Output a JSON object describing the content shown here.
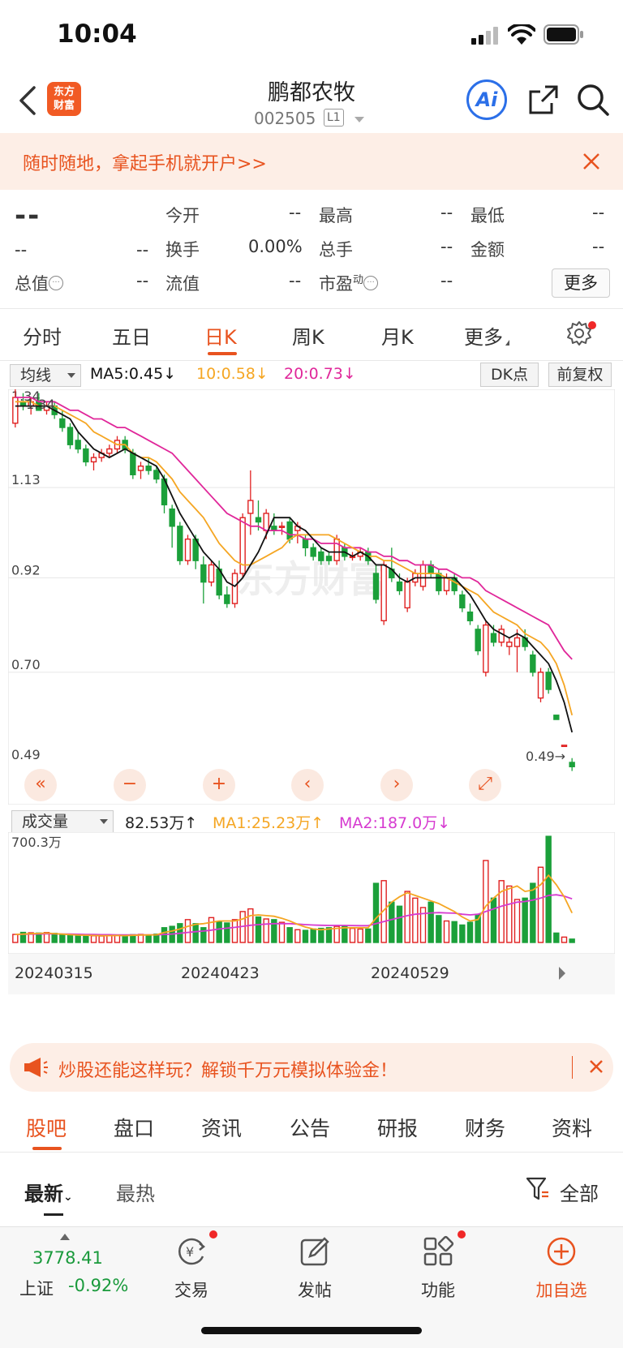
{
  "status_bar": {
    "time": "10:04"
  },
  "header": {
    "logo_text_line1": "东方",
    "logo_text_line2": "财富",
    "stock_name": "鹏都农牧",
    "stock_code": "002505",
    "level": "L1",
    "ai_label": "Ai"
  },
  "promo_top": {
    "text": "随时随地，拿起手机就开户>>"
  },
  "quote": {
    "price": "--",
    "change": "--",
    "change_pct": "--",
    "rows": [
      [
        {
          "label": "今开",
          "value": "--"
        },
        {
          "label": "最高",
          "value": "--"
        },
        {
          "label": "最低",
          "value": "--"
        }
      ],
      [
        {
          "label": "换手",
          "value": "0.00%"
        },
        {
          "label": "总手",
          "value": "--"
        },
        {
          "label": "金额",
          "value": "--"
        }
      ],
      [
        {
          "label": "流值",
          "value": "--"
        },
        {
          "label": "市盈",
          "sup": "动",
          "value": "--"
        }
      ]
    ],
    "total_value_label": "总值",
    "total_value": "--",
    "more_label": "更多"
  },
  "period_tabs": [
    "分时",
    "五日",
    "日K",
    "周K",
    "月K",
    "更多"
  ],
  "period_active_index": 2,
  "ma_legend": {
    "selector": "均线",
    "ma5": "MA5:0.45",
    "ma10": "10:0.58",
    "ma20": "20:0.73",
    "dk_label": "DK点",
    "adjust_label": "前复权",
    "arrow_down": "↓"
  },
  "kline": {
    "watermark": "东方财富",
    "axis_labels": [
      "1.34",
      "1.13",
      "0.92",
      "0.70",
      "0.49"
    ],
    "high_marker": "1.34",
    "last_marker": "0.49→",
    "zoom_icons": [
      "«",
      "−",
      "+",
      "‹",
      "›",
      "⤢"
    ]
  },
  "volume_legend": {
    "selector": "成交量",
    "vol": "82.53万",
    "ma1": "MA1:25.23万",
    "ma2": "MA2:187.0万",
    "up_arrow": "↑",
    "down_arrow": "↓",
    "max_label": "700.3万"
  },
  "dates": [
    "20240315",
    "20240423",
    "20240529"
  ],
  "colors": {
    "up": "#e02020",
    "down": "#1ba03a",
    "ma5": "#111111",
    "ma10": "#f5a623",
    "ma20": "#e0279a",
    "accent": "#e8531f"
  },
  "chart_data": {
    "type": "candlestick",
    "ohlc": [
      [
        1.28,
        1.36,
        1.27,
        1.34
      ],
      [
        1.33,
        1.35,
        1.31,
        1.32
      ],
      [
        1.32,
        1.34,
        1.3,
        1.33
      ],
      [
        1.33,
        1.35,
        1.31,
        1.31
      ],
      [
        1.31,
        1.33,
        1.3,
        1.32
      ],
      [
        1.32,
        1.33,
        1.29,
        1.3
      ],
      [
        1.29,
        1.31,
        1.26,
        1.27
      ],
      [
        1.27,
        1.28,
        1.22,
        1.23
      ],
      [
        1.24,
        1.26,
        1.21,
        1.22
      ],
      [
        1.22,
        1.23,
        1.18,
        1.19
      ],
      [
        1.19,
        1.21,
        1.17,
        1.2
      ],
      [
        1.2,
        1.22,
        1.19,
        1.21
      ],
      [
        1.21,
        1.23,
        1.2,
        1.22
      ],
      [
        1.22,
        1.25,
        1.21,
        1.24
      ],
      [
        1.24,
        1.25,
        1.21,
        1.22
      ],
      [
        1.21,
        1.22,
        1.15,
        1.16
      ],
      [
        1.17,
        1.19,
        1.15,
        1.18
      ],
      [
        1.18,
        1.2,
        1.16,
        1.17
      ],
      [
        1.17,
        1.18,
        1.14,
        1.15
      ],
      [
        1.15,
        1.16,
        1.07,
        1.09
      ],
      [
        1.08,
        1.09,
        0.99,
        1.04
      ],
      [
        1.04,
        1.05,
        0.95,
        0.96
      ],
      [
        0.96,
        1.02,
        0.95,
        1.01
      ],
      [
        1.01,
        1.02,
        0.94,
        0.96
      ],
      [
        0.95,
        0.97,
        0.86,
        0.91
      ],
      [
        0.91,
        0.96,
        0.9,
        0.95
      ],
      [
        0.94,
        0.96,
        0.87,
        0.88
      ],
      [
        0.88,
        0.9,
        0.85,
        0.86
      ],
      [
        0.86,
        0.94,
        0.85,
        0.93
      ],
      [
        0.93,
        1.07,
        0.92,
        1.06
      ],
      [
        1.07,
        1.17,
        1.02,
        1.1
      ],
      [
        1.06,
        1.1,
        1.03,
        1.05
      ],
      [
        1.03,
        1.08,
        1.01,
        1.07
      ],
      [
        1.04,
        1.07,
        1.02,
        1.03
      ],
      [
        1.04,
        1.05,
        1.02,
        1.04
      ],
      [
        1.05,
        1.06,
        1.0,
        1.01
      ],
      [
        1.03,
        1.05,
        1.0,
        1.04
      ],
      [
        1.01,
        1.02,
        0.97,
        0.99
      ],
      [
        0.99,
        1.0,
        0.96,
        0.97
      ],
      [
        0.98,
        0.99,
        0.95,
        0.96
      ],
      [
        0.97,
        0.98,
        0.95,
        0.96
      ],
      [
        0.96,
        1.02,
        0.95,
        1.01
      ],
      [
        0.99,
        1.0,
        0.96,
        0.97
      ],
      [
        0.97,
        0.98,
        0.96,
        0.97
      ],
      [
        0.97,
        0.99,
        0.96,
        0.98
      ],
      [
        0.98,
        0.99,
        0.95,
        0.96
      ],
      [
        0.93,
        0.95,
        0.86,
        0.87
      ],
      [
        0.82,
        0.96,
        0.81,
        0.95
      ],
      [
        0.94,
        0.99,
        0.91,
        0.92
      ],
      [
        0.91,
        0.93,
        0.88,
        0.89
      ],
      [
        0.85,
        0.92,
        0.84,
        0.91
      ],
      [
        0.91,
        0.94,
        0.9,
        0.93
      ],
      [
        0.9,
        0.96,
        0.89,
        0.95
      ],
      [
        0.95,
        0.96,
        0.92,
        0.93
      ],
      [
        0.93,
        0.94,
        0.88,
        0.89
      ],
      [
        0.89,
        0.93,
        0.88,
        0.92
      ],
      [
        0.92,
        0.93,
        0.88,
        0.89
      ],
      [
        0.88,
        0.89,
        0.84,
        0.85
      ],
      [
        0.84,
        0.86,
        0.81,
        0.82
      ],
      [
        0.8,
        0.81,
        0.74,
        0.75
      ],
      [
        0.7,
        0.82,
        0.69,
        0.81
      ],
      [
        0.79,
        0.81,
        0.76,
        0.77
      ],
      [
        0.77,
        0.81,
        0.76,
        0.8
      ],
      [
        0.76,
        0.78,
        0.74,
        0.77
      ],
      [
        0.76,
        0.8,
        0.7,
        0.78
      ],
      [
        0.78,
        0.8,
        0.75,
        0.76
      ],
      [
        0.74,
        0.75,
        0.69,
        0.7
      ],
      [
        0.64,
        0.71,
        0.63,
        0.7
      ],
      [
        0.7,
        0.71,
        0.65,
        0.66
      ],
      [
        0.6,
        0.6,
        0.59,
        0.59
      ],
      [
        0.53,
        0.53,
        0.53,
        0.53
      ],
      [
        0.49,
        0.5,
        0.47,
        0.48
      ]
    ],
    "ma5": [
      1.32,
      1.32,
      1.32,
      1.32,
      1.32,
      1.31,
      1.3,
      1.29,
      1.26,
      1.24,
      1.22,
      1.21,
      1.2,
      1.21,
      1.22,
      1.21,
      1.2,
      1.19,
      1.18,
      1.15,
      1.11,
      1.07,
      1.04,
      1.01,
      0.98,
      0.96,
      0.94,
      0.91,
      0.9,
      0.92,
      0.95,
      0.98,
      1.02,
      1.06,
      1.06,
      1.06,
      1.04,
      1.03,
      1.01,
      0.99,
      0.98,
      0.98,
      0.98,
      0.97,
      0.98,
      0.97,
      0.95,
      0.95,
      0.94,
      0.92,
      0.91,
      0.92,
      0.92,
      0.92,
      0.92,
      0.92,
      0.92,
      0.9,
      0.88,
      0.85,
      0.82,
      0.8,
      0.79,
      0.78,
      0.79,
      0.78,
      0.76,
      0.74,
      0.72,
      0.68,
      0.63,
      0.56
    ],
    "ma10": [
      1.33,
      1.33,
      1.33,
      1.32,
      1.32,
      1.32,
      1.31,
      1.3,
      1.29,
      1.28,
      1.26,
      1.25,
      1.24,
      1.23,
      1.23,
      1.21,
      1.2,
      1.2,
      1.19,
      1.17,
      1.15,
      1.12,
      1.1,
      1.08,
      1.06,
      1.03,
      1.0,
      0.98,
      0.96,
      0.95,
      0.95,
      0.96,
      0.97,
      0.98,
      0.99,
      1.01,
      1.02,
      1.02,
      1.02,
      1.02,
      1.02,
      1.01,
      1.0,
      0.99,
      0.98,
      0.97,
      0.97,
      0.96,
      0.96,
      0.95,
      0.94,
      0.93,
      0.93,
      0.93,
      0.93,
      0.92,
      0.91,
      0.9,
      0.89,
      0.88,
      0.86,
      0.84,
      0.83,
      0.82,
      0.81,
      0.79,
      0.78,
      0.77,
      0.75,
      0.72,
      0.67,
      0.6
    ],
    "ma20": [
      1.34,
      1.34,
      1.34,
      1.33,
      1.33,
      1.33,
      1.32,
      1.31,
      1.31,
      1.3,
      1.29,
      1.29,
      1.28,
      1.27,
      1.27,
      1.26,
      1.25,
      1.24,
      1.23,
      1.22,
      1.21,
      1.19,
      1.17,
      1.15,
      1.13,
      1.11,
      1.09,
      1.07,
      1.06,
      1.05,
      1.04,
      1.04,
      1.03,
      1.03,
      1.03,
      1.02,
      1.02,
      1.01,
      1.01,
      1.0,
      1.0,
      1.0,
      0.99,
      0.99,
      0.99,
      0.98,
      0.98,
      0.97,
      0.97,
      0.96,
      0.96,
      0.95,
      0.95,
      0.95,
      0.94,
      0.94,
      0.93,
      0.92,
      0.92,
      0.91,
      0.89,
      0.88,
      0.87,
      0.86,
      0.85,
      0.84,
      0.83,
      0.82,
      0.81,
      0.78,
      0.75,
      0.73
    ],
    "volume": [
      60,
      75,
      72,
      70,
      74,
      68,
      58,
      55,
      52,
      55,
      50,
      48,
      52,
      54,
      50,
      58,
      60,
      55,
      62,
      110,
      120,
      140,
      170,
      140,
      110,
      185,
      155,
      145,
      170,
      230,
      250,
      190,
      175,
      170,
      150,
      110,
      95,
      90,
      100,
      105,
      110,
      120,
      125,
      105,
      100,
      100,
      440,
      460,
      300,
      270,
      380,
      330,
      260,
      300,
      200,
      160,
      155,
      130,
      150,
      210,
      610,
      330,
      460,
      420,
      320,
      330,
      440,
      560,
      790,
      70,
      40,
      25
    ],
    "vol_ma1": [
      60,
      62,
      65,
      67,
      70,
      66,
      62,
      58,
      55,
      54,
      52,
      50,
      51,
      52,
      51,
      53,
      55,
      56,
      57,
      75,
      85,
      100,
      120,
      135,
      140,
      150,
      160,
      160,
      160,
      175,
      200,
      205,
      200,
      195,
      180,
      160,
      135,
      115,
      100,
      95,
      100,
      105,
      110,
      110,
      110,
      110,
      180,
      240,
      300,
      340,
      370,
      350,
      330,
      310,
      290,
      260,
      230,
      190,
      160,
      170,
      270,
      330,
      380,
      400,
      420,
      380,
      390,
      430,
      500,
      430,
      340,
      220
    ],
    "vol_ma2": [
      60,
      61,
      62,
      63,
      64,
      64,
      63,
      62,
      61,
      60,
      59,
      58,
      58,
      57,
      56,
      56,
      56,
      57,
      57,
      60,
      63,
      68,
      75,
      80,
      85,
      92,
      100,
      106,
      112,
      120,
      128,
      133,
      137,
      140,
      140,
      140,
      137,
      133,
      130,
      128,
      127,
      127,
      127,
      126,
      125,
      125,
      140,
      155,
      170,
      185,
      200,
      210,
      215,
      220,
      222,
      220,
      218,
      210,
      205,
      210,
      230,
      250,
      270,
      285,
      300,
      305,
      315,
      330,
      350,
      355,
      345,
      325
    ],
    "ylim": [
      0.49,
      1.34
    ],
    "vol_max": 700.3
  },
  "promo_bottom": {
    "text": "炒股还能这样玩？解锁千万元模拟体验金！"
  },
  "section_tabs": [
    "股吧",
    "盘口",
    "资讯",
    "公告",
    "研报",
    "财务",
    "资料"
  ],
  "section_active_index": 0,
  "filter": {
    "latest": "最新",
    "hot": "最热",
    "all": "全部"
  },
  "bottom_bar": {
    "index_value": "3778.41",
    "index_name": "上证",
    "index_change": "-0.92%",
    "items": [
      "交易",
      "发帖",
      "功能",
      "加自选"
    ]
  }
}
